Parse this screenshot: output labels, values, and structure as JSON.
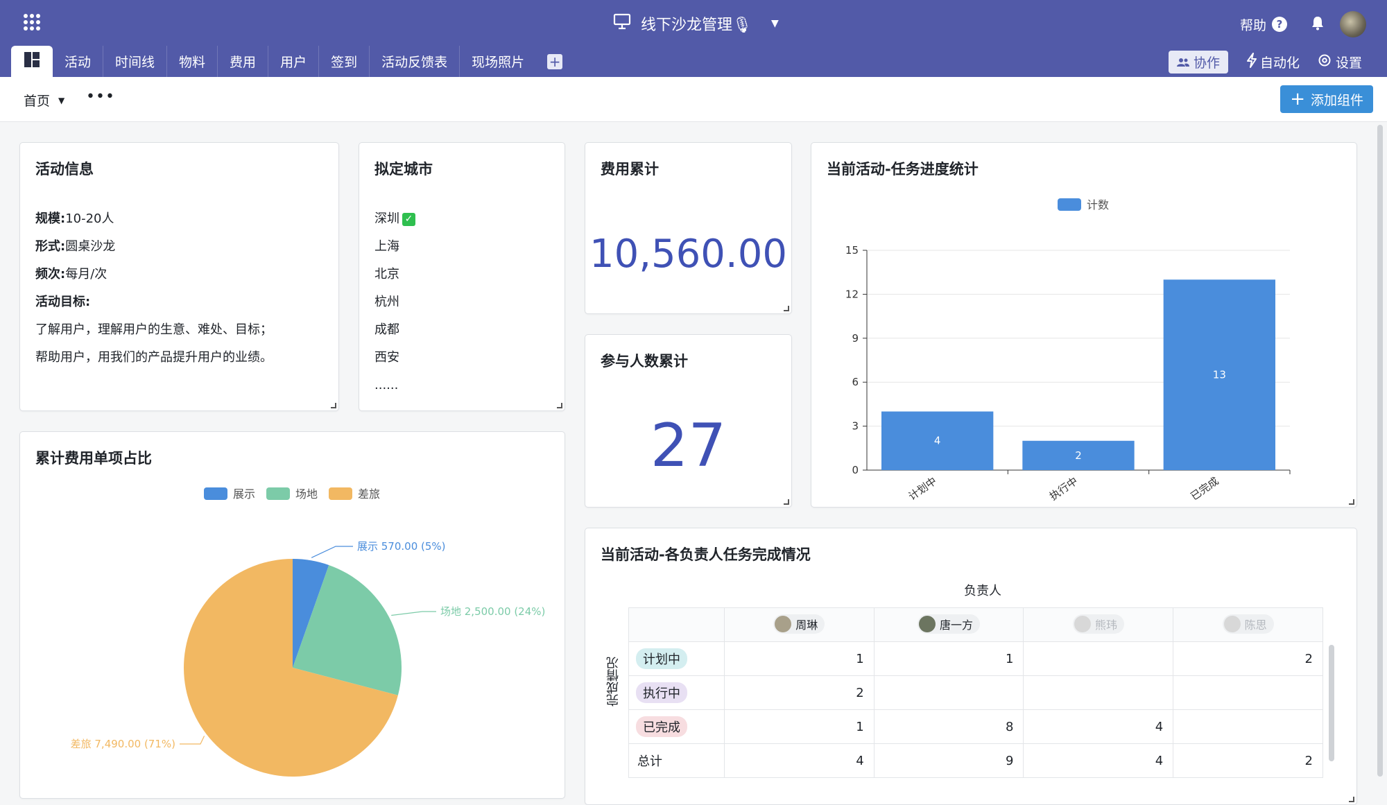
{
  "app": {
    "title": "线下沙龙管理🎙",
    "help_label": "帮助",
    "help_mark": "?"
  },
  "tabs": [
    "活动",
    "时间线",
    "物料",
    "费用",
    "用户",
    "签到",
    "活动反馈表",
    "现场照片"
  ],
  "toolbar": {
    "collab": "协作",
    "automation": "自动化",
    "settings": "设置"
  },
  "subbar": {
    "home": "首页",
    "more": "•••",
    "add_widget": "添加组件",
    "add_plus": "+"
  },
  "info_card": {
    "title": "活动信息",
    "rows": [
      {
        "label": "规模",
        "value": "10-20人"
      },
      {
        "label": "形式",
        "value": "圆桌沙龙"
      },
      {
        "label": "频次",
        "value": "每月/次"
      }
    ],
    "goal_label": "活动目标:",
    "goal_lines": [
      "了解用户，理解用户的生意、难处、目标；",
      "帮助用户，用我们的产品提升用户的业绩。"
    ]
  },
  "city_card": {
    "title": "拟定城市",
    "cities": [
      "深圳",
      "上海",
      "北京",
      "杭州",
      "成都",
      "西安",
      "......"
    ],
    "check_mark": "✓"
  },
  "cost_card": {
    "title": "费用累计",
    "value": "10,560.00"
  },
  "people_card": {
    "title": "参与人数累计",
    "value": "27"
  },
  "bar_card": {
    "title": "当前活动-任务进度统计"
  },
  "pie_card": {
    "title": "累计费用单项占比"
  },
  "table_card": {
    "title": "当前活动-各负责人任务完成情况",
    "col_header": "负责人",
    "row_header": "完成情况",
    "people": [
      {
        "name": "周琳",
        "faded": false
      },
      {
        "name": "唐一方",
        "faded": false
      },
      {
        "name": "熊玮",
        "faded": true
      },
      {
        "name": "陈思",
        "faded": true
      }
    ],
    "rows": [
      {
        "label": "计划中",
        "color": "#d4eef0",
        "values": [
          "1",
          "1",
          "",
          "2"
        ]
      },
      {
        "label": "执行中",
        "color": "#e8e0f3",
        "values": [
          "2",
          "",
          "",
          ""
        ]
      },
      {
        "label": "已完成",
        "color": "#f7dde0",
        "values": [
          "1",
          "8",
          "4",
          ""
        ]
      },
      {
        "label": "总计",
        "color": "",
        "values": [
          "4",
          "9",
          "4",
          "2"
        ]
      }
    ]
  },
  "chart_data": [
    {
      "type": "bar",
      "title": "当前活动-任务进度统计",
      "categories": [
        "计划中",
        "执行中",
        "已完成"
      ],
      "series": [
        {
          "name": "计数",
          "values": [
            4,
            2,
            13
          ],
          "color": "#4a8ddc"
        }
      ],
      "ylim": [
        0,
        15
      ],
      "yticks": [
        0,
        3,
        6,
        9,
        12,
        15
      ],
      "legend": "top-center",
      "grid": true
    },
    {
      "type": "pie",
      "title": "累计费用单项占比",
      "slices": [
        {
          "name": "展示",
          "value": 570.0,
          "label": "展示 570.00 (5%)",
          "color": "#4a8ddc"
        },
        {
          "name": "场地",
          "value": 2500.0,
          "label": "场地 2,500.00 (24%)",
          "color": "#7ccba8"
        },
        {
          "name": "差旅",
          "value": 7490.0,
          "label": "差旅 7,490.00 (71%)",
          "color": "#f2b862"
        }
      ],
      "legend": "top-center"
    }
  ]
}
